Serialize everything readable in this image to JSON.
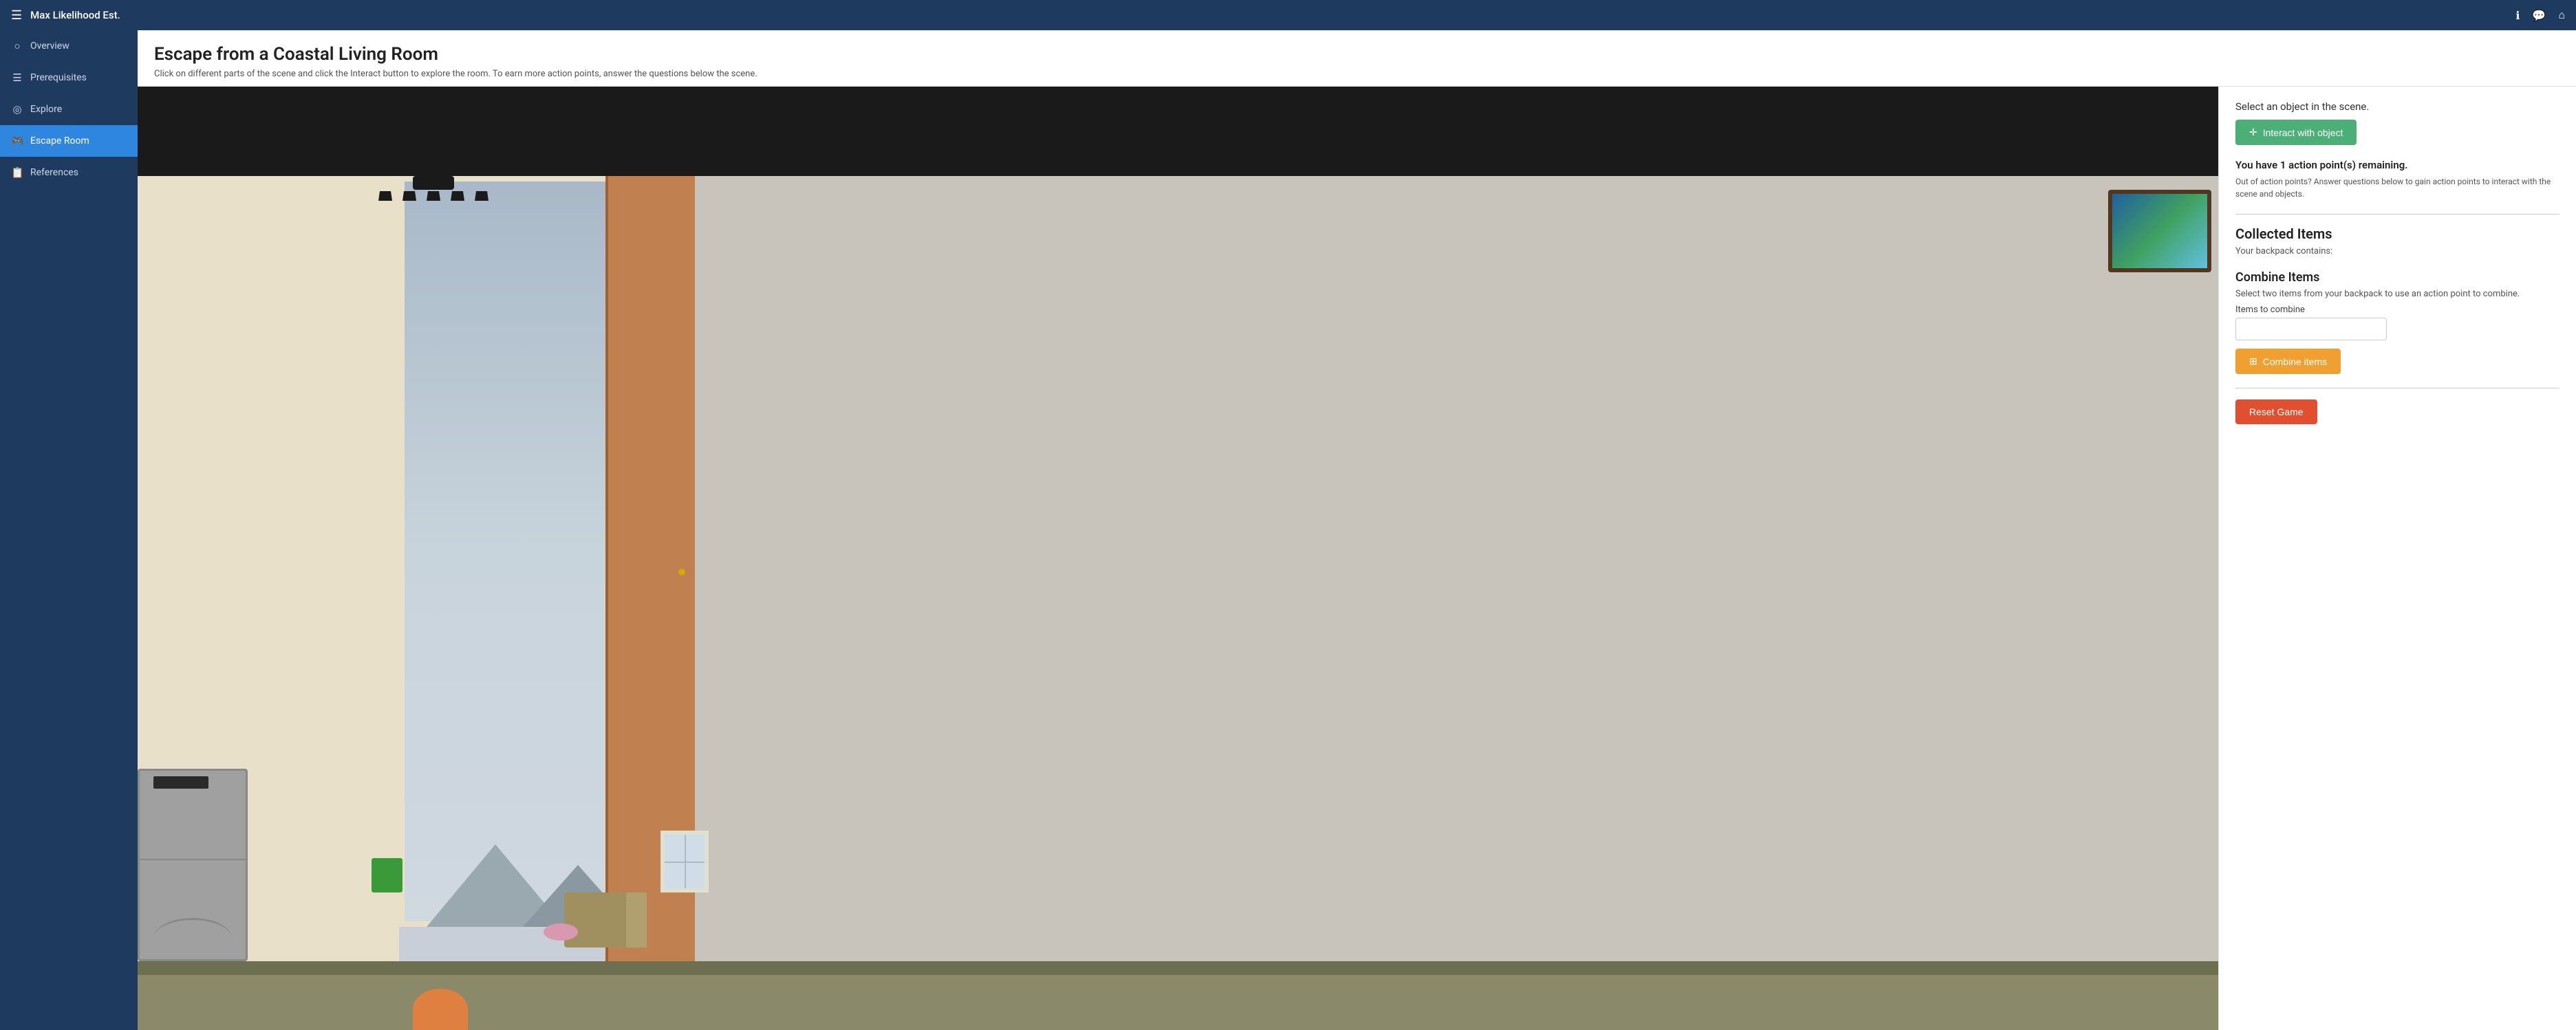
{
  "app": {
    "title": "Max Likelihood Est.",
    "icons": {
      "menu": "☰",
      "info": "ℹ",
      "chat": "💬",
      "home": "⌂"
    }
  },
  "sidebar": {
    "items": [
      {
        "id": "overview",
        "label": "Overview",
        "icon": "○",
        "active": false
      },
      {
        "id": "prerequisites",
        "label": "Prerequisites",
        "icon": "☰",
        "active": false
      },
      {
        "id": "explore",
        "label": "Explore",
        "icon": "◎",
        "active": false
      },
      {
        "id": "escape-room",
        "label": "Escape Room",
        "icon": "🎮",
        "active": true
      },
      {
        "id": "references",
        "label": "References",
        "icon": "📋",
        "active": false
      }
    ]
  },
  "page": {
    "title": "Escape from a Coastal Living Room",
    "subtitle": "Click on different parts of the scene and click the Interact button to explore the room. To earn more action points, answer the questions below the scene."
  },
  "right_panel": {
    "select_label": "Select an object in the scene.",
    "interact_button": "Interact with object",
    "action_points_text": "You have 1 action point(s) remaining.",
    "action_points_sub": "Out of action points? Answer questions below to gain action points to interact with the scene and objects.",
    "collected_items_heading": "Collected Items",
    "backpack_label": "Your backpack contains:",
    "combine_items_heading": "Combine Items",
    "combine_items_desc": "Select two items from your backpack to use an action point to combine.",
    "items_to_combine_label": "Items to combine",
    "items_input_value": "",
    "items_input_placeholder": "",
    "combine_button": "Combine items",
    "reset_button": "Reset Game"
  }
}
